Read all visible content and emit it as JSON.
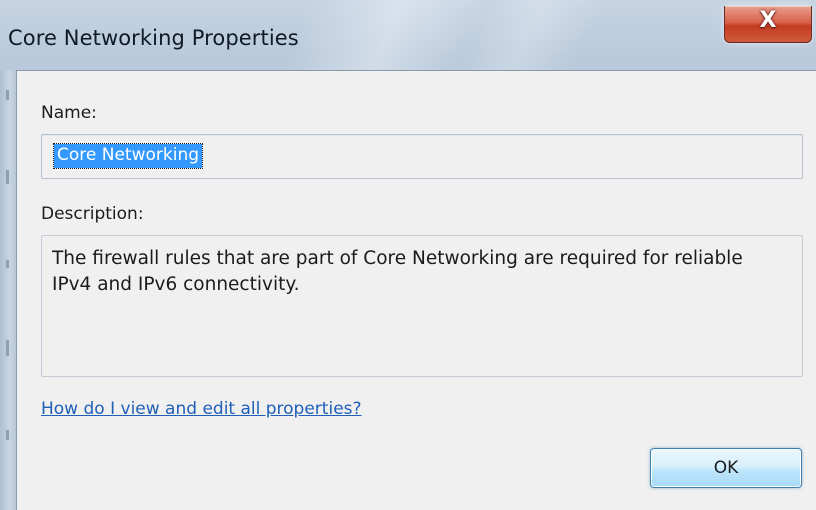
{
  "window": {
    "title": "Core Networking Properties",
    "close_symbol": "X",
    "close_icon": "close-icon"
  },
  "form": {
    "name_label": "Name:",
    "name_value": "Core Networking",
    "description_label": "Description:",
    "description_value": "The firewall rules that are part of Core Networking are required for reliable IPv4 and IPv6 connectivity."
  },
  "help_link": "How do I view and edit all properties?",
  "buttons": {
    "ok_label": "OK"
  },
  "colors": {
    "selection": "#3399ff",
    "link": "#1f5fb8",
    "close_button": "#c43c23",
    "ok_button_border": "#3c7fb1"
  }
}
